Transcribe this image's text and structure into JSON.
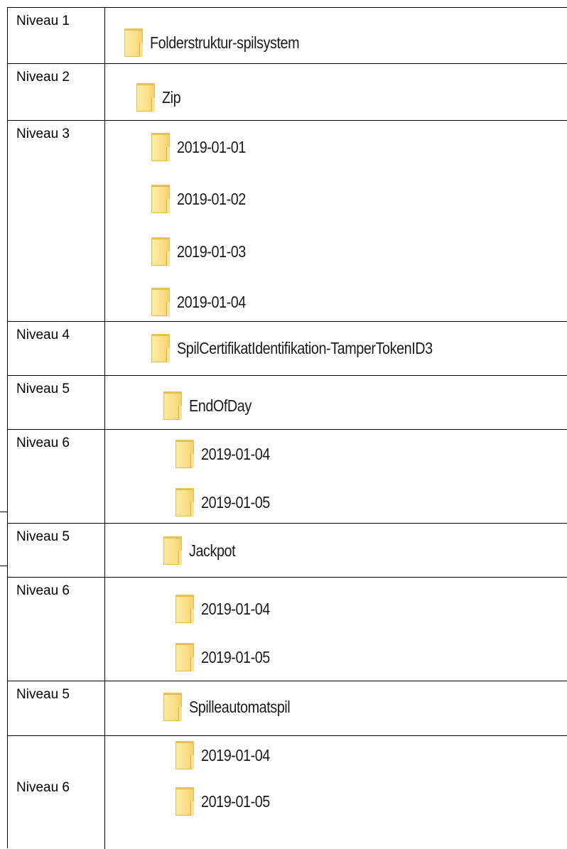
{
  "rows": [
    {
      "level": "Niveau 1",
      "folders": [
        "Folderstruktur-spilsystem"
      ]
    },
    {
      "level": "Niveau 2",
      "folders": [
        "Zip"
      ]
    },
    {
      "level": "Niveau 3",
      "folders": [
        "2019-01-01",
        "2019-01-02",
        "2019-01-03",
        "2019-01-04"
      ]
    },
    {
      "level": "Niveau 4",
      "folders": [
        "SpilCertifikatIdentifikation-TamperTokenID3"
      ]
    },
    {
      "level": "Niveau 5",
      "folders": [
        "EndOfDay"
      ]
    },
    {
      "level": "Niveau 6",
      "folders": [
        "2019-01-04",
        "2019-01-05"
      ]
    },
    {
      "level": "Niveau 5",
      "folders": [
        "Jackpot"
      ]
    },
    {
      "level": "Niveau 6",
      "folders": [
        "2019-01-04",
        "2019-01-05"
      ]
    },
    {
      "level": "Niveau 5",
      "folders": [
        "Spilleautomatspil"
      ]
    },
    {
      "level": "Niveau 6",
      "folders": [
        "2019-01-04",
        "2019-01-05"
      ]
    }
  ]
}
